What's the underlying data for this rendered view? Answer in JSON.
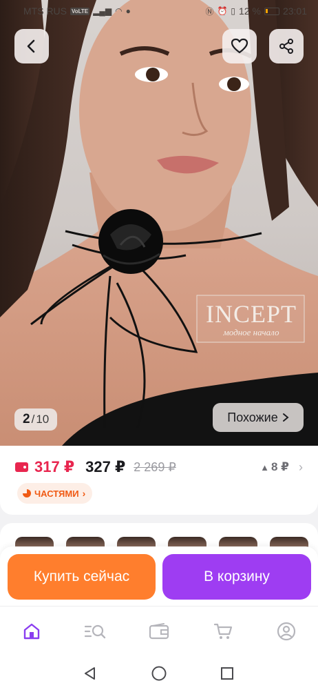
{
  "status_bar": {
    "carrier": "MTS RUS",
    "volte": "VoLTE",
    "battery": "12 %",
    "time": "23:01"
  },
  "photo": {
    "watermark_brand": "INCEPT",
    "watermark_tagline": "модное начало",
    "counter_current": "2",
    "counter_total": "10",
    "similar_label": "Похожие"
  },
  "price": {
    "card_price": "317 ₽",
    "price": "327 ₽",
    "old_price": "2 269 ₽",
    "price_drop": "8 ₽",
    "installment_label": "ЧАСТЯМИ"
  },
  "actions": {
    "buy_now": "Купить сейчас",
    "add_to_cart": "В корзину"
  },
  "colors": {
    "accent_red": "#e8264f",
    "buy_orange": "#ff7e2d",
    "cart_purple": "#9e3df2",
    "nav_active": "#8a3df0",
    "nav_inactive": "#b5b5bb"
  },
  "bottom_nav": [
    {
      "icon": "home-icon",
      "active": true
    },
    {
      "icon": "catalog-search-icon",
      "active": false
    },
    {
      "icon": "wallet-icon",
      "active": false
    },
    {
      "icon": "cart-icon",
      "active": false
    },
    {
      "icon": "profile-icon",
      "active": false
    }
  ],
  "system_nav": [
    "back-triangle-icon",
    "home-circle-icon",
    "recents-square-icon"
  ]
}
